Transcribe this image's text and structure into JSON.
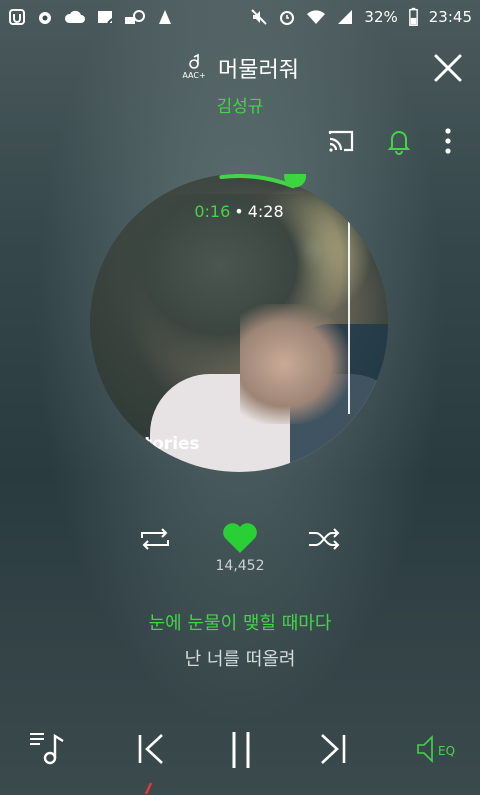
{
  "status_bar": {
    "battery_percent": "32%",
    "time": "23:45",
    "icons_left": [
      "u-icon",
      "music-icon",
      "cloud-icon",
      "note-icon",
      "c-icon",
      "app-icon"
    ],
    "icons_right": [
      "mute-icon",
      "alarm-icon",
      "wifi-icon",
      "signal-icon",
      "battery-icon"
    ]
  },
  "header": {
    "audio_badge": "AAC+",
    "title": "머물러줘",
    "artist": "김성규"
  },
  "album": {
    "art_text": "tories",
    "time_current": "0:16",
    "time_separator": "•",
    "time_total": "4:28",
    "progress": 0.06
  },
  "controls": {
    "likes_count": "14,452"
  },
  "lyrics": {
    "current": "눈에 눈물이 맺힐 때마다",
    "next": "난 너를 떠올려"
  },
  "bottom": {
    "eq_label": "EQ"
  },
  "colors": {
    "accent": "#45d34a",
    "text": "#ffffff",
    "muted": "#ccd2d2"
  }
}
